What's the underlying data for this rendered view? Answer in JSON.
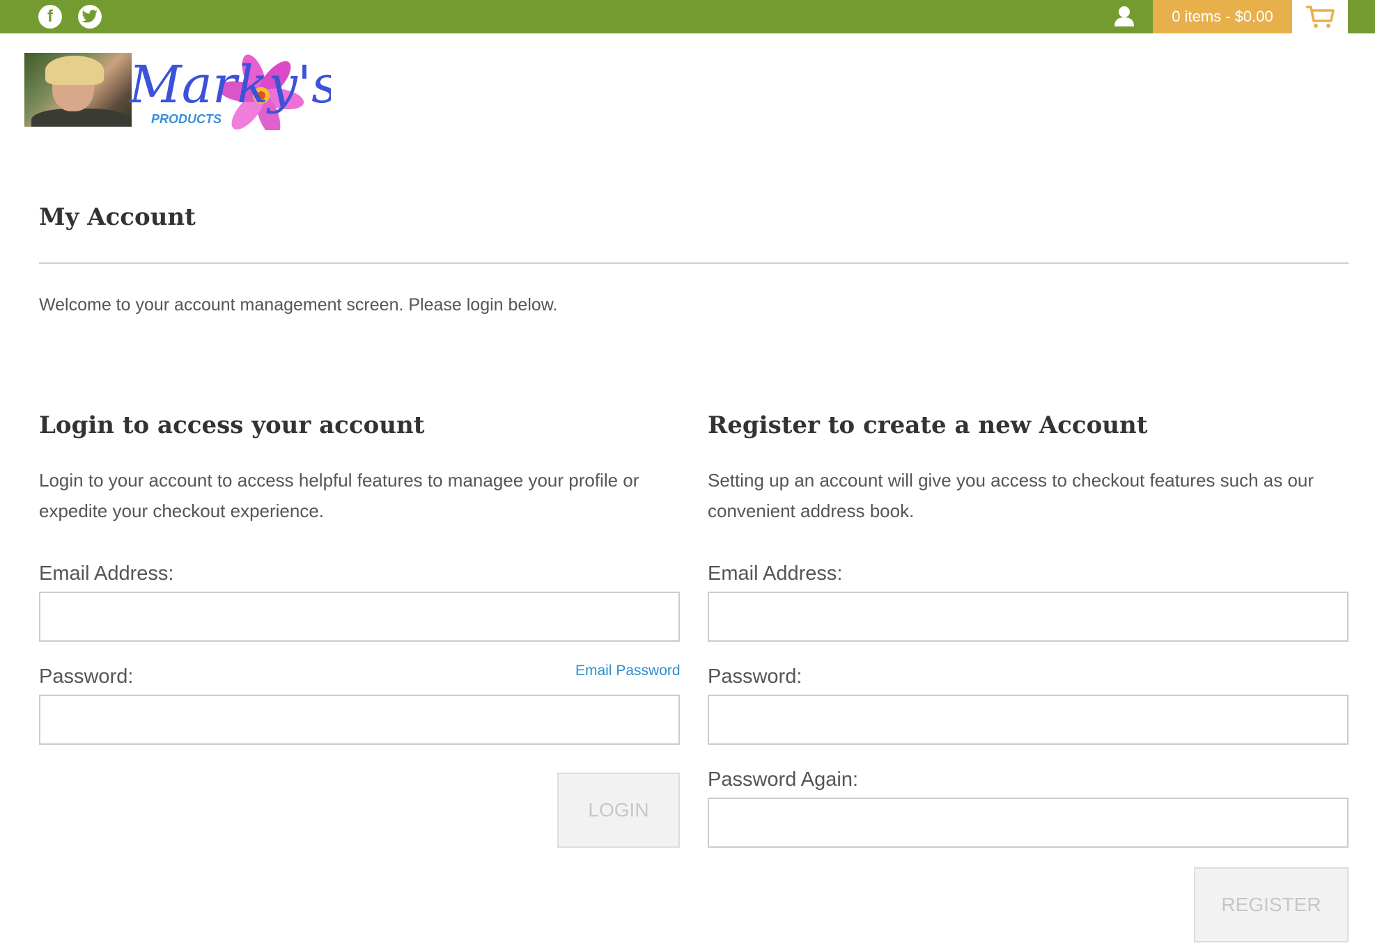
{
  "topbar": {
    "background_color": "#749b30",
    "social": [
      {
        "icon": "facebook-icon",
        "glyph": "f"
      },
      {
        "icon": "twitter-icon"
      }
    ],
    "account_icon": "user-icon",
    "cart_summary": "0 items - $0.00",
    "cart_summary_color": "#e8b04b",
    "cart_icon": "cart-icon"
  },
  "logo": {
    "script_text": "Marky's",
    "sub_text": "PRODUCTS"
  },
  "page": {
    "title": "My Account",
    "welcome": "Welcome to your account management screen. Please login below."
  },
  "login": {
    "heading": "Login to access your account",
    "description": "Login to your account to access helpful features to managee your profile or expedite your checkout experience.",
    "email_label": "Email Address:",
    "email_value": "",
    "password_label": "Password:",
    "password_value": "",
    "forgot_link": "Email Password",
    "submit_label": "LOGIN"
  },
  "register": {
    "heading": "Register to create a new Account",
    "description": "Setting up an account will give you access to checkout features such as our convenient address book.",
    "email_label": "Email Address:",
    "email_value": "",
    "password_label": "Password:",
    "password_value": "",
    "password_again_label": "Password Again:",
    "password_again_value": "",
    "submit_label": "REGISTER"
  }
}
